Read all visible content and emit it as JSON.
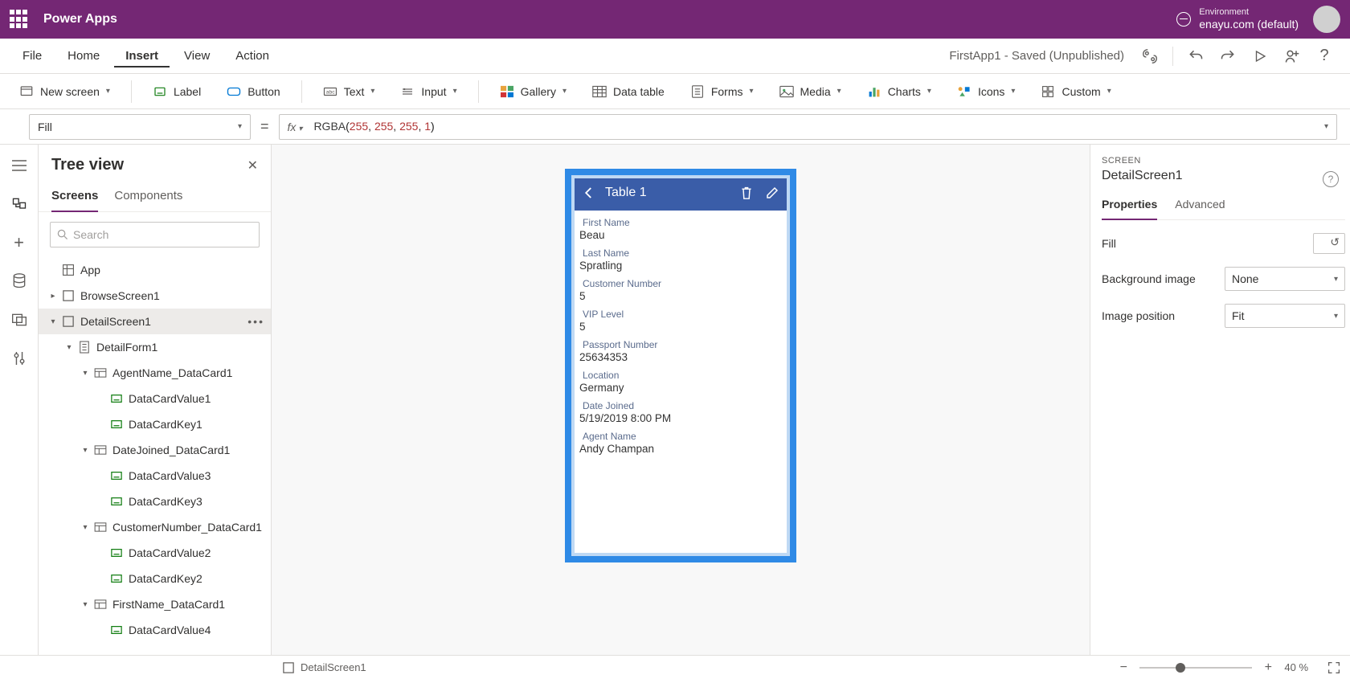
{
  "titlebar": {
    "app_name": "Power Apps",
    "env_label": "Environment",
    "env_name": "enayu.com (default)"
  },
  "menubar": {
    "items": [
      "File",
      "Home",
      "Insert",
      "View",
      "Action"
    ],
    "active_index": 2,
    "doc_status": "FirstApp1 - Saved (Unpublished)"
  },
  "ribbon": {
    "new_screen": "New screen",
    "label": "Label",
    "button": "Button",
    "text": "Text",
    "input": "Input",
    "gallery": "Gallery",
    "data_table": "Data table",
    "forms": "Forms",
    "media": "Media",
    "charts": "Charts",
    "icons": "Icons",
    "custom": "Custom"
  },
  "formula": {
    "property": "Fill",
    "fx_label": "fx",
    "fn": "RGBA",
    "args": [
      "255",
      "255",
      "255",
      "1"
    ]
  },
  "treeview": {
    "title": "Tree view",
    "tabs": [
      "Screens",
      "Components"
    ],
    "active_tab": 0,
    "search_placeholder": "Search",
    "nodes": {
      "app": "App",
      "browse": "BrowseScreen1",
      "detail": "DetailScreen1",
      "form": "DetailForm1",
      "card_agent": "AgentName_DataCard1",
      "dcv1": "DataCardValue1",
      "dck1": "DataCardKey1",
      "card_date": "DateJoined_DataCard1",
      "dcv3": "DataCardValue3",
      "dck3": "DataCardKey3",
      "card_cust": "CustomerNumber_DataCard1",
      "dcv2": "DataCardValue2",
      "dck2": "DataCardKey2",
      "card_first": "FirstName_DataCard1",
      "dcv4": "DataCardValue4"
    }
  },
  "canvas": {
    "header": "Table 1",
    "fields": [
      {
        "label": "First Name",
        "value": "Beau"
      },
      {
        "label": "Last Name",
        "value": "Spratling"
      },
      {
        "label": "Customer Number",
        "value": "5"
      },
      {
        "label": "VIP Level",
        "value": "5"
      },
      {
        "label": "Passport Number",
        "value": "25634353"
      },
      {
        "label": "Location",
        "value": "Germany"
      },
      {
        "label": "Date Joined",
        "value": "5/19/2019 8:00 PM"
      },
      {
        "label": "Agent Name",
        "value": "Andy Champan"
      }
    ]
  },
  "props": {
    "type_label": "SCREEN",
    "name": "DetailScreen1",
    "tabs": [
      "Properties",
      "Advanced"
    ],
    "active_tab": 0,
    "fill_label": "Fill",
    "bgimg_label": "Background image",
    "bgimg_value": "None",
    "imgpos_label": "Image position",
    "imgpos_value": "Fit"
  },
  "statusbar": {
    "screen_name": "DetailScreen1",
    "zoom_value": "40",
    "zoom_pct": "%"
  }
}
